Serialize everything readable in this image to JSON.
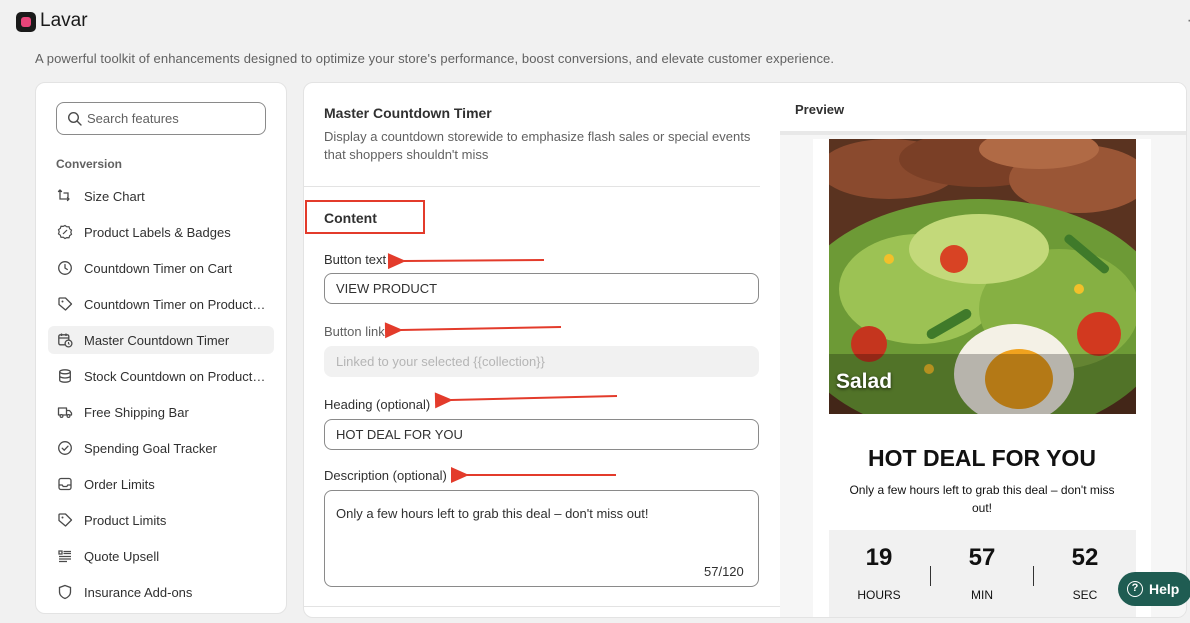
{
  "app": {
    "title": "Lavar",
    "tagline": "A powerful toolkit of enhancements designed to optimize your store's performance, boost conversions, and elevate customer experience."
  },
  "sidebar": {
    "search_placeholder": "Search features",
    "section_title": "Conversion",
    "items": [
      {
        "label": "Size Chart",
        "icon": "ruler-icon"
      },
      {
        "label": "Product Labels & Badges",
        "icon": "badge-icon"
      },
      {
        "label": "Countdown Timer on Cart",
        "icon": "clock-icon"
      },
      {
        "label": "Countdown Timer on Product Page",
        "icon": "tag-timer-icon"
      },
      {
        "label": "Master Countdown Timer",
        "icon": "calendar-clock-icon",
        "active": true
      },
      {
        "label": "Stock Countdown on Product Page",
        "icon": "database-icon"
      },
      {
        "label": "Free Shipping Bar",
        "icon": "truck-icon"
      },
      {
        "label": "Spending Goal Tracker",
        "icon": "check-circle-icon"
      },
      {
        "label": "Order Limits",
        "icon": "inbox-icon"
      },
      {
        "label": "Product Limits",
        "icon": "tag-icon"
      },
      {
        "label": "Quote Upsell",
        "icon": "quote-icon"
      },
      {
        "label": "Insurance Add-ons",
        "icon": "shield-icon"
      }
    ]
  },
  "panel": {
    "title": "Master Countdown Timer",
    "description": "Display a countdown storewide to emphasize flash sales or special events that shoppers shouldn't miss",
    "section": "Content",
    "fields": {
      "button_text": {
        "label": "Button text",
        "value": "VIEW PRODUCT"
      },
      "button_link": {
        "label": "Button link",
        "placeholder": "Linked to your selected {{collection}}"
      },
      "heading": {
        "label": "Heading (optional)",
        "value": "HOT DEAL FOR YOU"
      },
      "description": {
        "label": "Description (optional)",
        "value": "Only a few hours left to grab this deal – don't miss out!",
        "count": "57/120"
      }
    }
  },
  "preview": {
    "title": "Preview",
    "image_label": "Salad",
    "heading": "HOT DEAL FOR YOU",
    "description": "Only a few hours left to grab this deal – don't miss out!",
    "timer": [
      {
        "value": "19",
        "label": "HOURS"
      },
      {
        "value": "57",
        "label": "MIN"
      },
      {
        "value": "52",
        "label": "SEC"
      }
    ]
  },
  "help": {
    "label": "Help",
    "icon": "question-icon"
  },
  "colors": {
    "annotation": "#e33b2b",
    "help_button": "#1f5c52",
    "logo_accent": "#e8457a"
  }
}
